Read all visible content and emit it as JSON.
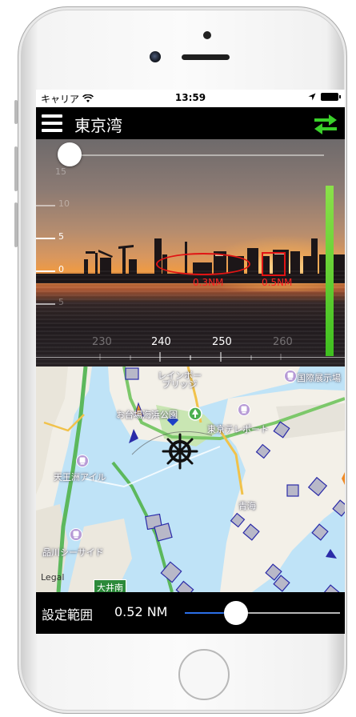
{
  "status_bar": {
    "carrier": "キャリア",
    "time": "13:59"
  },
  "nav": {
    "title": "東京湾"
  },
  "camera": {
    "elevation_scale": [
      "15",
      "10",
      "5",
      "0",
      "5"
    ],
    "bearing_scale": [
      "230",
      "240",
      "250",
      "260"
    ],
    "targets": [
      {
        "distance": "0.3NM"
      },
      {
        "distance": "0.5NM"
      }
    ],
    "top_slider_value": 0,
    "level_color": "#3fbf1f"
  },
  "map": {
    "labels": {
      "rainbow_bridge": "レインボー\nブリッジ",
      "odaiba_park": "お台場海浜公園",
      "tokyo_teleport": "東京テレポート",
      "exhibition": "国際展示場",
      "tennozu": "天王洲アイル",
      "aomi": "青海",
      "shinagawa": "品川シーサイド",
      "legal": "Legal",
      "road": "大井南"
    }
  },
  "bottom": {
    "range_label": "設定範囲",
    "range_value": "0.52 NM",
    "slider_fraction": 0.33
  },
  "colors": {
    "accent_green": "#3ad12a",
    "target_red": "#e01414",
    "slider_blue": "#2b6fe8"
  }
}
